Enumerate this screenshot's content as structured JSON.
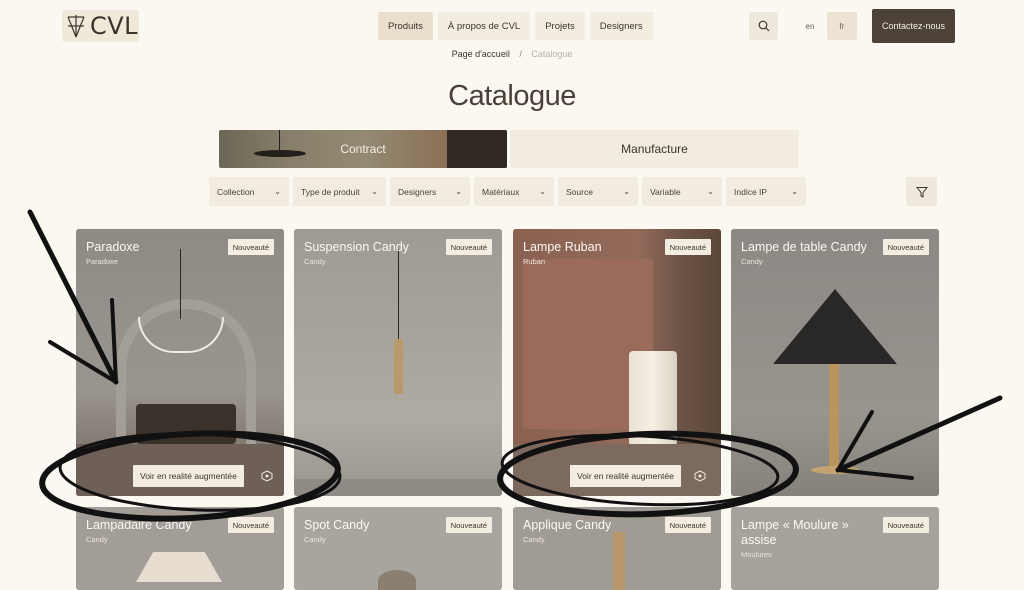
{
  "header": {
    "logo_text": "CVL",
    "nav": [
      "Produits",
      "À propos de CVL",
      "Projets",
      "Designers"
    ],
    "lang_en": "en",
    "lang_fr": "fr",
    "contact_label": "Contactez-nous"
  },
  "breadcrumb": {
    "home": "Page d'accueil",
    "separator": "/",
    "current": "Catalogue"
  },
  "page_title": "Catalogue",
  "tabs": [
    "Contract",
    "Manufacture"
  ],
  "filters": [
    "Collection",
    "Type de produit",
    "Designers",
    "Matériaux",
    "Source",
    "Variable",
    "Indice IP"
  ],
  "products": [
    {
      "title": "Paradoxe",
      "subtitle": "Paradoxe",
      "badge": "Nouveauté",
      "ar_label": "Voir en realité augmentée"
    },
    {
      "title": "Suspension Candy",
      "subtitle": "Candy",
      "badge": "Nouveauté"
    },
    {
      "title": "Lampe Ruban",
      "subtitle": "Ruban",
      "badge": "Nouveauté",
      "ar_label": "Voir en realité augmentée"
    },
    {
      "title": "Lampe de table Candy",
      "subtitle": "Candy",
      "badge": "Nouveauté"
    },
    {
      "title": "Lampadaire Candy",
      "subtitle": "Candy",
      "badge": "Nouveauté"
    },
    {
      "title": "Spot Candy",
      "subtitle": "Candy",
      "badge": "Nouveauté"
    },
    {
      "title": "Applique Candy",
      "subtitle": "Candy",
      "badge": "Nouveauté"
    },
    {
      "title": "Lampe « Moulure » assise",
      "subtitle": "Moulures",
      "badge": "Nouveauté"
    }
  ],
  "icons": {
    "search": "search-icon",
    "filter": "filter-icon",
    "ar": "ar-cube-icon",
    "chevron": "chevron-down-icon"
  },
  "colors": {
    "background": "#fbf8f2",
    "contact_button": "#4c4238",
    "active_nav": "#e9dfcc",
    "badge": "#f3ece0"
  }
}
